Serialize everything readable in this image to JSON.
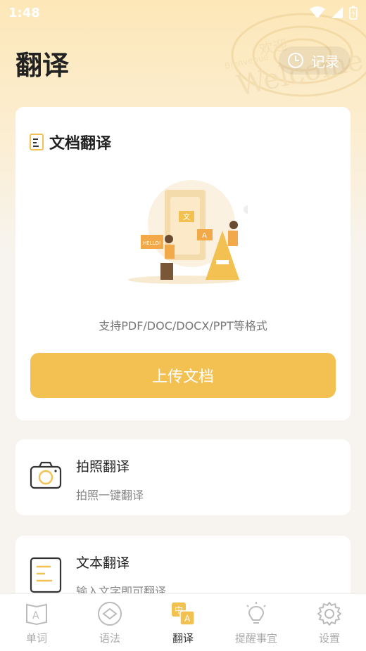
{
  "status_bar": {
    "time": "1:48"
  },
  "header": {
    "title": "翻译",
    "record_label": "记录"
  },
  "doc_card": {
    "title": "文档翻译",
    "support_text": "支持PDF/DOC/DOCX/PPT等格式",
    "upload_label": "上传文档",
    "illustration_texts": {
      "hello": "HELLO!",
      "wen": "文",
      "a": "A"
    }
  },
  "features": [
    {
      "title": "拍照翻译",
      "subtitle": "拍照一键翻译"
    },
    {
      "title": "文本翻译",
      "subtitle": "输入文字即可翻译"
    }
  ],
  "tabs": [
    {
      "label": "单词",
      "icon": "book-a-icon",
      "active": false
    },
    {
      "label": "语法",
      "icon": "tag-icon",
      "active": false
    },
    {
      "label": "翻译",
      "icon": "translate-icon",
      "active": true
    },
    {
      "label": "提醒事宜",
      "icon": "lightbulb-icon",
      "active": false
    },
    {
      "label": "设置",
      "icon": "gear-icon",
      "active": false
    }
  ],
  "globe_words": [
    "Welcome",
    "Bienvenue",
    "欢迎"
  ],
  "colors": {
    "accent": "#f2c151",
    "header_bg": "#fde7b8",
    "page_bg": "#f7f4ef"
  }
}
